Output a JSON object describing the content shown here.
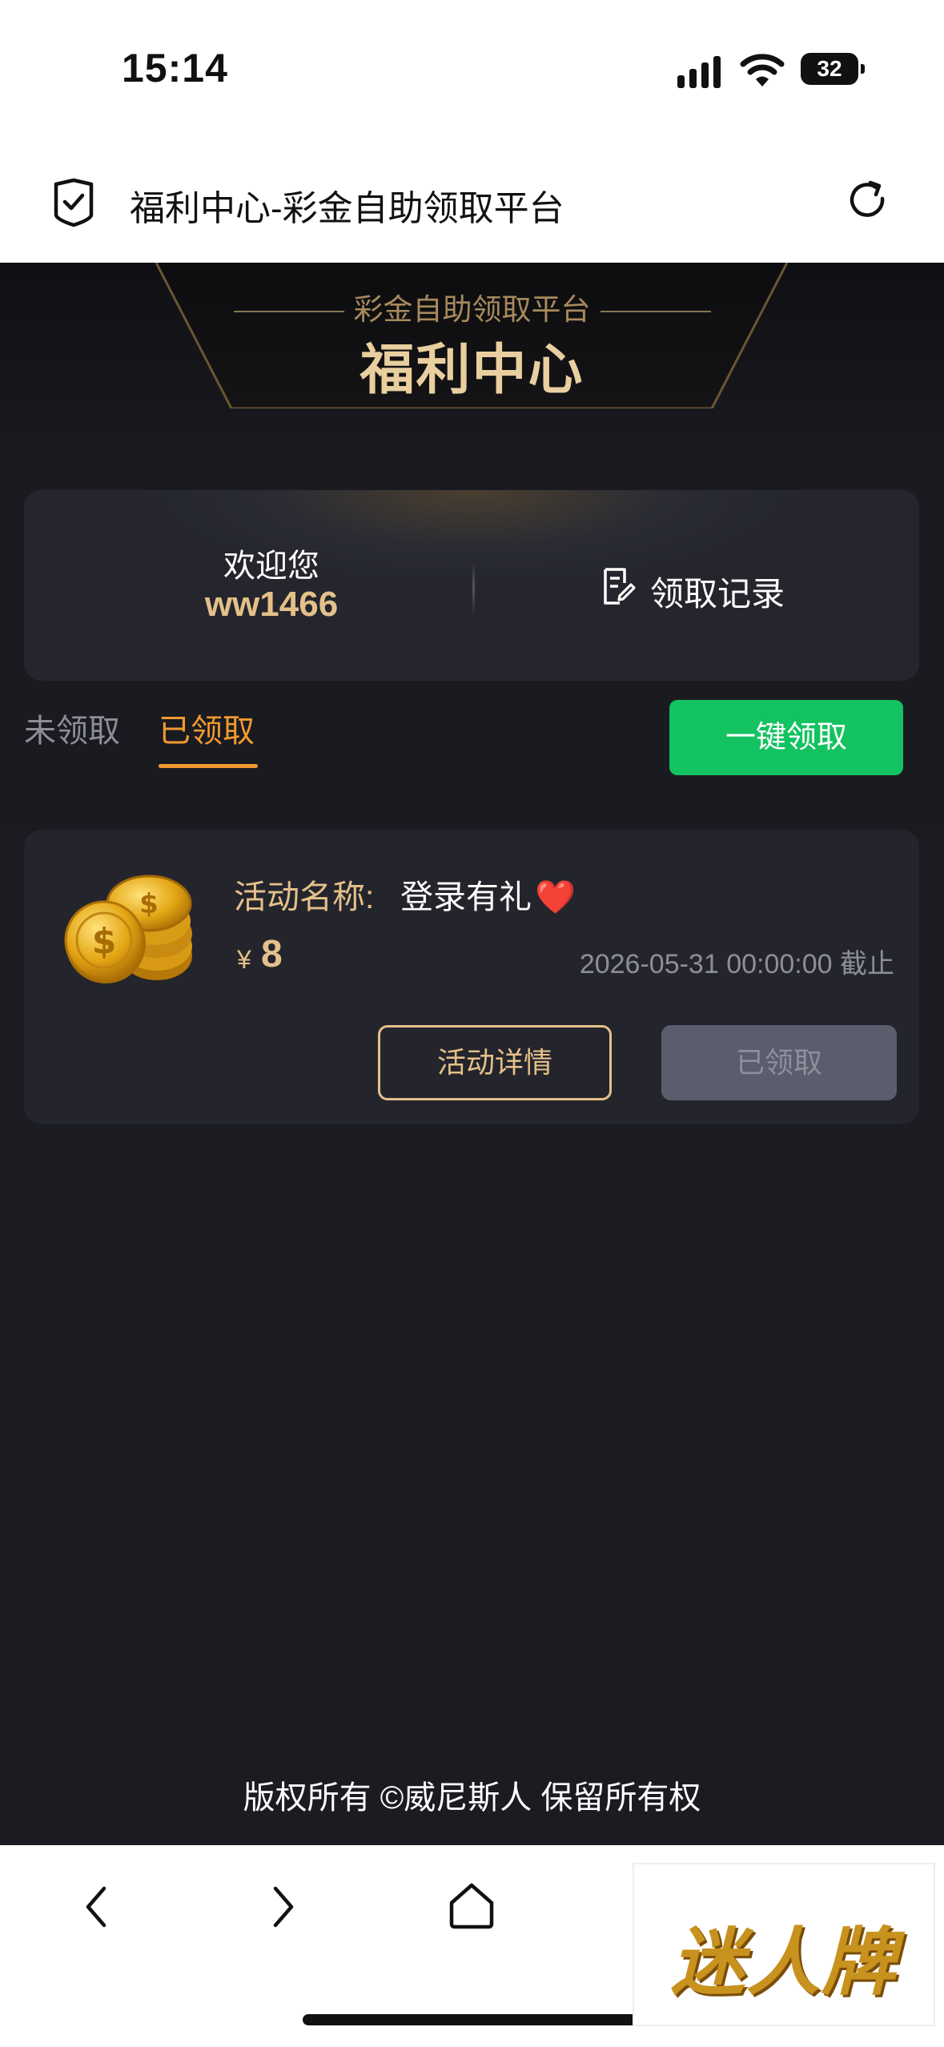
{
  "status_bar": {
    "time": "15:14",
    "battery": "32"
  },
  "browser": {
    "page_title": "福利中心-彩金自助领取平台"
  },
  "banner": {
    "subtitle": "彩金自助领取平台",
    "title": "福利中心"
  },
  "welcome": {
    "label": "欢迎您",
    "username": "ww1466",
    "records_label": "领取记录"
  },
  "tabs": [
    {
      "label": "未领取",
      "active": false
    },
    {
      "label": "已领取",
      "active": true
    }
  ],
  "claim_all_label": "一键领取",
  "activity": {
    "name_label": "活动名称:",
    "name": "登录有礼",
    "name_emoji": "❤️",
    "currency": "¥",
    "amount": "8",
    "deadline": "2026-05-31 00:00:00 截止",
    "detail_label": "活动详情",
    "status_label": "已领取"
  },
  "footer": {
    "copyright": "版权所有 ©威尼斯人 保留所有权"
  },
  "watermark": {
    "text": "迷人牌"
  },
  "colors": {
    "gold": "#e4c08a",
    "orange_tab": "#f29a2e",
    "green_button": "#13c260",
    "dark_bg": "#1b1c22"
  }
}
